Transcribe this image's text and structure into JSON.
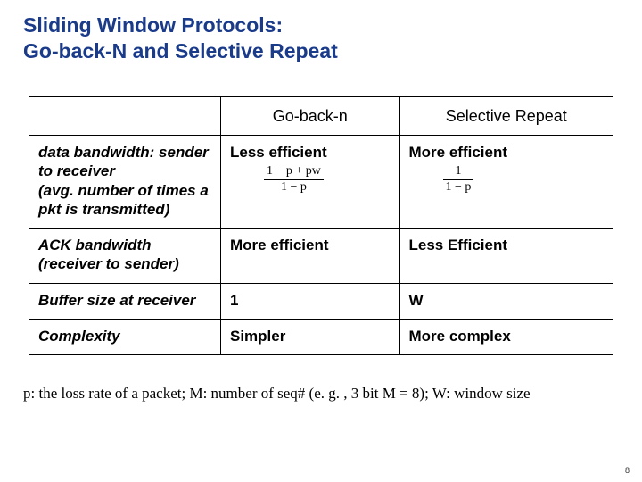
{
  "title_line1": "Sliding Window Protocols:",
  "title_line2": "Go-back-N and Selective Repeat",
  "chart_data": {
    "type": "table",
    "columns": [
      "",
      "Go-back-n",
      "Selective Repeat"
    ],
    "rows": [
      {
        "label": "data bandwidth: sender to receiver\n(avg. number of times a pkt is transmitted)",
        "go_back_n": {
          "text": "Less efficient",
          "formula_num": "1 − p + pw",
          "formula_den": "1 − p"
        },
        "selective_repeat": {
          "text": "More efficient",
          "formula_num": "1",
          "formula_den": "1 − p"
        }
      },
      {
        "label": "ACK bandwidth (receiver to sender)",
        "go_back_n": "More efficient",
        "selective_repeat": "Less Efficient"
      },
      {
        "label": "Buffer size at receiver",
        "go_back_n": "1",
        "selective_repeat": "W"
      },
      {
        "label": "Complexity",
        "go_back_n": "Simpler",
        "selective_repeat": "More complex"
      }
    ]
  },
  "headers": {
    "col1": "Go-back-n",
    "col2": "Selective Repeat"
  },
  "row0": {
    "label_l1": "data bandwidth: sender to receiver",
    "label_l2": "(avg. number of times a pkt is transmitted)",
    "gbn_text": "Less efficient",
    "gbn_num": "1 − p + pw",
    "gbn_den": "1 − p",
    "sr_text": "More efficient",
    "sr_num": "1",
    "sr_den": "1 − p"
  },
  "row1": {
    "label": "ACK bandwidth (receiver to sender)",
    "gbn": "More efficient",
    "sr": "Less Efficient"
  },
  "row2": {
    "label": "Buffer size at receiver",
    "gbn": "1",
    "sr": "W"
  },
  "row3": {
    "label": "Complexity",
    "gbn": "Simpler",
    "sr": "More complex"
  },
  "footnote": "p: the loss rate of a packet; M: number of seq# (e. g. , 3 bit M = 8); W: window size",
  "pagenum": "8"
}
